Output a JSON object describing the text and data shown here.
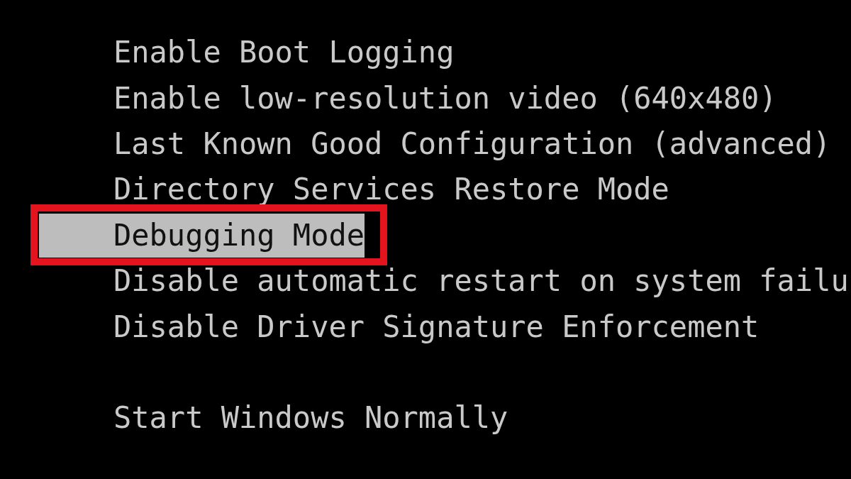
{
  "sections": [
    {
      "items": [
        {
          "label": "Enable Boot Logging",
          "selected": false,
          "annotated": false
        },
        {
          "label": "Enable low-resolution video (640x480)",
          "selected": false,
          "annotated": false
        },
        {
          "label": "Last Known Good Configuration (advanced)",
          "selected": false,
          "annotated": false
        },
        {
          "label": "Directory Services Restore Mode",
          "selected": false,
          "annotated": false
        },
        {
          "label": "Debugging Mode",
          "selected": true,
          "annotated": true
        },
        {
          "label": "Disable automatic restart on system failu",
          "selected": false,
          "annotated": false
        },
        {
          "label": "Disable Driver Signature Enforcement",
          "selected": false,
          "annotated": false
        }
      ]
    },
    {
      "items": [
        {
          "label": "Start Windows Normally",
          "selected": false,
          "annotated": false
        }
      ]
    }
  ]
}
